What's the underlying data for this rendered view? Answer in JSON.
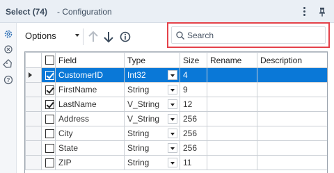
{
  "window": {
    "title": "Select (74)",
    "subtitle": "- Configuration"
  },
  "toolbar": {
    "options_label": "Options"
  },
  "search": {
    "placeholder": "Search",
    "value": ""
  },
  "grid": {
    "columns": [
      "Field",
      "Type",
      "Size",
      "Rename",
      "Description"
    ],
    "rows": [
      {
        "checked": true,
        "field": "CustomerID",
        "type": "Int32",
        "size": "4",
        "rename": "",
        "description": "",
        "selected": true
      },
      {
        "checked": true,
        "field": "FirstName",
        "type": "String",
        "size": "9",
        "rename": "",
        "description": "",
        "selected": false
      },
      {
        "checked": true,
        "field": "LastName",
        "type": "V_String",
        "size": "12",
        "rename": "",
        "description": "",
        "selected": false
      },
      {
        "checked": false,
        "field": "Address",
        "type": "V_String",
        "size": "256",
        "rename": "",
        "description": "",
        "selected": false
      },
      {
        "checked": false,
        "field": "City",
        "type": "String",
        "size": "256",
        "rename": "",
        "description": "",
        "selected": false
      },
      {
        "checked": false,
        "field": "State",
        "type": "String",
        "size": "256",
        "rename": "",
        "description": "",
        "selected": false
      },
      {
        "checked": false,
        "field": "ZIP",
        "type": "String",
        "size": "11",
        "rename": "",
        "description": "",
        "selected": false
      }
    ]
  },
  "colors": {
    "selection": "#0a78d7",
    "highlight_border": "#e4424a",
    "titlebar": "#eaeff5"
  },
  "icons": [
    "gear-icon",
    "tag-icon",
    "help-icon",
    "kebab-menu-icon",
    "pin-icon",
    "move-up-icon",
    "move-down-icon",
    "info-icon",
    "search-icon"
  ]
}
